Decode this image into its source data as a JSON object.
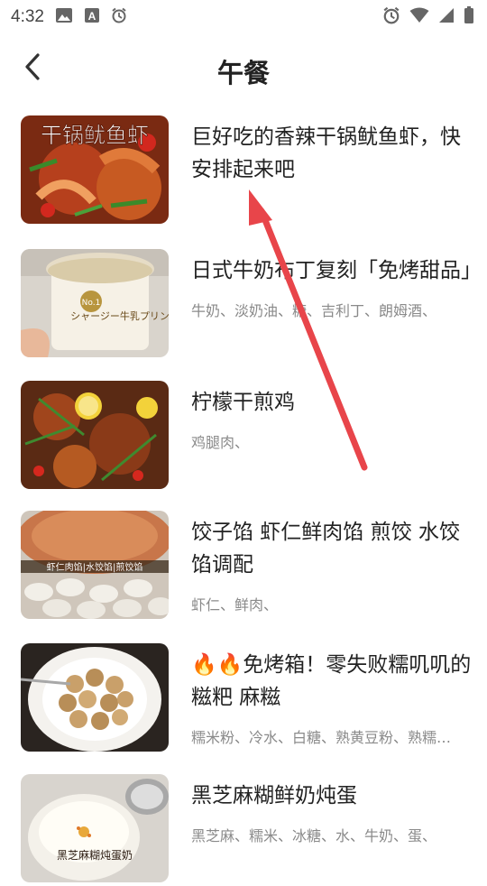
{
  "status_bar": {
    "time": "4:32",
    "left_icons": [
      "image-icon",
      "font-a-icon",
      "alarm-clock-icon"
    ],
    "right_icons": [
      "alarm-clock-icon",
      "wifi-icon",
      "signal-icon",
      "battery-icon"
    ]
  },
  "header": {
    "title": "午餐",
    "back_icon": "chevron-left-icon"
  },
  "recipes": [
    {
      "title": "巨好吃的香辣干锅鱿鱼虾，快安排起来吧",
      "ingredients": "",
      "thumb_caption": "干锅鱿鱼虾"
    },
    {
      "title": "日式牛奶布丁复刻「免烤甜品」",
      "ingredients": "牛奶、淡奶油、糖、吉利丁、朗姆酒、",
      "thumb_caption": "シャージー牛乳プリン"
    },
    {
      "title": "柠檬干煎鸡",
      "ingredients": "鸡腿肉、",
      "thumb_caption": ""
    },
    {
      "title": "饺子馅 虾仁鲜肉馅 煎饺 水饺馅调配",
      "ingredients": "虾仁、鲜肉、",
      "thumb_caption": "虾仁肉馅|水饺馅|煎饺馅"
    },
    {
      "title": "🔥🔥免烤箱！零失败糯叽叽的糍粑 麻糍",
      "ingredients": "糯米粉、冷水、白糖、熟黄豆粉、熟糯米粉、",
      "thumb_caption": ""
    },
    {
      "title": "黑芝麻糊鲜奶炖蛋",
      "ingredients": "黑芝麻、糯米、冰糖、水、牛奶、蛋、",
      "thumb_caption": "黑芝麻糊炖蛋奶"
    }
  ],
  "colors": {
    "annotation_arrow": "#e8454a",
    "ingredient_text": "#8a8a8a"
  }
}
